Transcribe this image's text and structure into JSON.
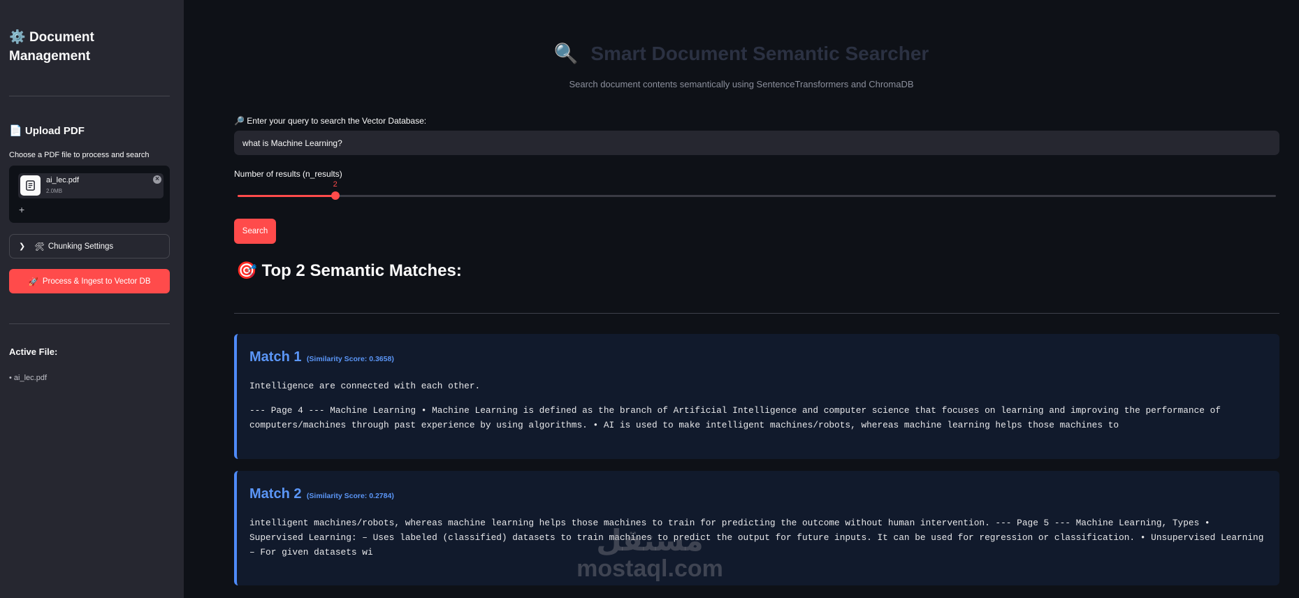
{
  "sidebar": {
    "title": "Document Management",
    "upload_heading": "Upload PDF",
    "uploader_label": "Choose a PDF file to process and search",
    "uploaded_file": {
      "name": "ai_lec.pdf",
      "size": "2.0MB"
    },
    "add_symbol": "+",
    "chunking_label": "Chunking Settings",
    "process_button": "Process & Ingest to Vector DB",
    "active_file_label": "Active File:",
    "active_file": "• ai_lec.pdf"
  },
  "main": {
    "title": "Smart Document Semantic Searcher",
    "subtitle": "Search document contents semantically using SentenceTransformers and ChromaDB",
    "query_label": "Enter your query to search the Vector Database:",
    "query_value": "what is Machine Learning?",
    "results_label": "Number of results (n_results)",
    "slider": {
      "value": "2",
      "fraction": 0.094
    },
    "search_button": "Search",
    "results_heading": "Top 2 Semantic Matches:",
    "matches": [
      {
        "title": "Match 1",
        "score": "(Similarity Score: 0.3658)",
        "paragraphs": [
          "Intelligence are connected with each other.",
          "--- Page 4 --- Machine Learning • Machine Learning is defined as the branch of Artificial Intelligence and computer science that focuses on learning and improving the performance of computers/machines through past experience by using algorithms. • AI is used to make intelligent machines/robots, whereas machine learning helps those machines to"
        ]
      },
      {
        "title": "Match 2",
        "score": "(Similarity Score: 0.2784)",
        "paragraphs": [
          "intelligent machines/robots, whereas machine learning helps those machines to train for predicting the outcome without human intervention. --- Page 5 --- Machine Learning, Types • Supervised Learning: – Uses labeled (classified) datasets to train machines to predict the output for future inputs. It can be used for regression or classification. • Unsupervised Learning – For given datasets wi"
        ]
      }
    ]
  },
  "watermark": {
    "arabic": "مستقل",
    "latin": "mostaql.com"
  },
  "colors": {
    "accent": "#ff4b4b",
    "match_blue": "#5b96f7",
    "background": "#0e1117",
    "sidebar": "#262730"
  }
}
